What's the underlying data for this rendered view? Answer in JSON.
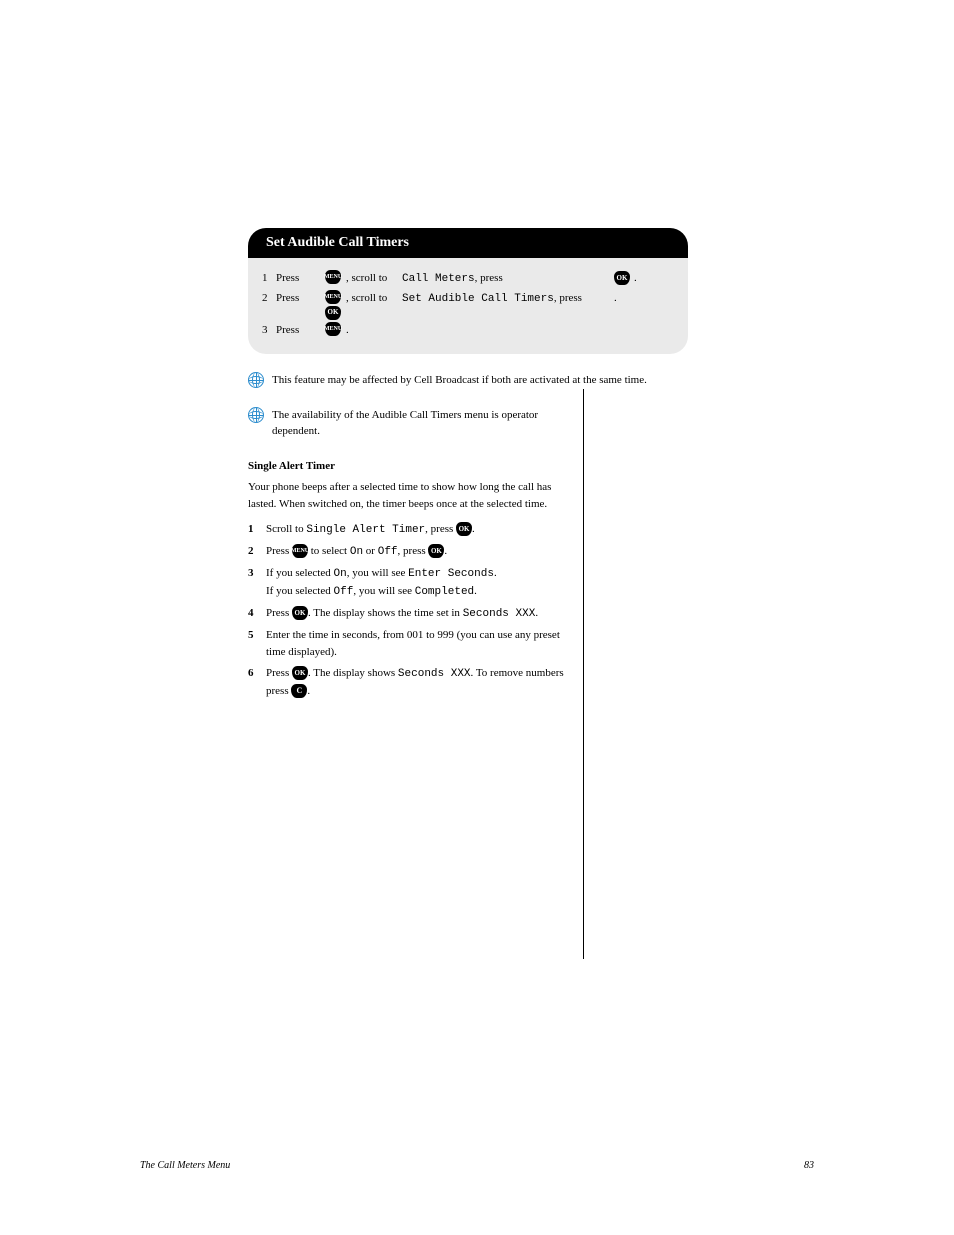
{
  "card": {
    "title": "Set Audible Call Timers",
    "steps": [
      {
        "bullet": "1",
        "press": "Press",
        "icons": [
          "MENU"
        ],
        "scroll": ", scroll to",
        "label": "Call Meters",
        "tail_press": ", press",
        "tail_icons": [
          "OK"
        ],
        "tail_dot": "."
      },
      {
        "bullet": "2",
        "press": "Press",
        "icons": [
          "MENU",
          "OK"
        ],
        "scroll": ", scroll to",
        "label": "Set Audible Call Timers",
        "tail_press": ", press",
        "tail_icons": [],
        "tail_dot": "."
      },
      {
        "bullet": "3",
        "press": "Press",
        "icons": [
          "MENU"
        ],
        "scroll": ".",
        "label": "",
        "tail_press": "",
        "tail_icons": [],
        "tail_dot": ""
      }
    ]
  },
  "notes": {
    "n1": "This feature may be affected by Cell Broadcast if both are activated at the same time.",
    "n2": "The availability of the Audible Call Timers menu is operator dependent."
  },
  "timers": {
    "heading": "Single Alert Timer",
    "intro": "Your phone beeps after a selected time to show how long the call has lasted. When switched on, the timer beeps once at the selected time.",
    "steps": {
      "s1_a": "Scroll to ",
      "s1_b": "Single Alert Timer",
      "s1_c": ", press ",
      "s1_d": ".",
      "s2_a": "Press ",
      "s2_b": " to select ",
      "s2_on": "On",
      "s2_or": " or ",
      "s2_off": "Off",
      "s2_c": ", press ",
      "s2_d": ".",
      "s3_a": "If you selected ",
      "s3_on": "On",
      "s3_b": ", you will see ",
      "s3_enter": "Enter Seconds",
      "s3_c": ".",
      "s3_d": "If you selected ",
      "s3_off": "Off",
      "s3_e": ", you will see ",
      "s3_comp": "Completed",
      "s3_f": ".",
      "s4_a": "Press ",
      "s4_b": ". The display shows the time set in ",
      "s4_sec": "Seconds XXX",
      "s4_c": ".",
      "s5_a": "Enter the time in seconds, from 001 to 999 (you can use any preset time displayed).",
      "s6_a": "Press ",
      "s6_b": ". The display shows ",
      "s6_sec": "Seconds XXX",
      "s6_c": ". To remove numbers press ",
      "s6_d": "."
    }
  },
  "footer": {
    "left": "The Call Meters Menu",
    "right": "83"
  }
}
